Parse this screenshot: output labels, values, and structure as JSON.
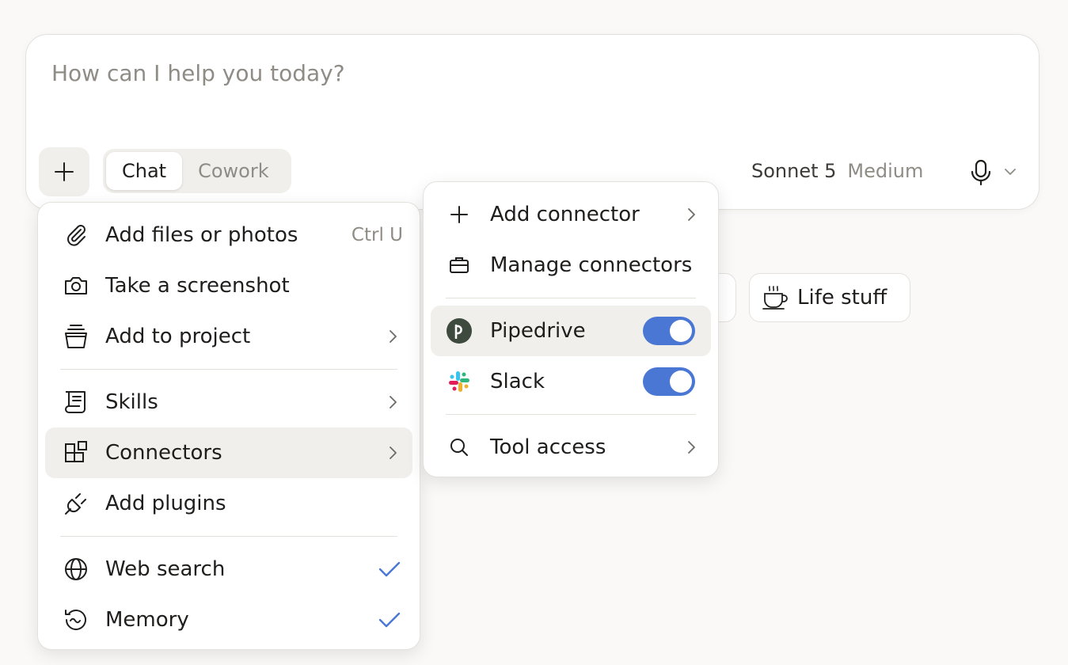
{
  "composer": {
    "placeholder": "How can I help you today?",
    "modes": [
      {
        "label": "Chat",
        "active": true
      },
      {
        "label": "Cowork",
        "active": false
      }
    ],
    "model_name": "Sonnet 5",
    "model_effort": "Medium"
  },
  "chips": {
    "life_stuff": "Life stuff"
  },
  "main_menu": {
    "add_files": {
      "label": "Add files or photos",
      "shortcut": "Ctrl U",
      "icon": "paperclip-icon"
    },
    "screenshot": {
      "label": "Take a screenshot",
      "icon": "camera-icon"
    },
    "add_to_project": {
      "label": "Add to project",
      "icon": "project-icon"
    },
    "skills": {
      "label": "Skills",
      "icon": "scroll-icon"
    },
    "connectors": {
      "label": "Connectors",
      "icon": "blocks-icon"
    },
    "add_plugins": {
      "label": "Add plugins",
      "icon": "plug-icon"
    },
    "web_search": {
      "label": "Web search",
      "icon": "globe-icon",
      "checked": true
    },
    "memory": {
      "label": "Memory",
      "icon": "memory-icon",
      "checked": true
    }
  },
  "sub_menu": {
    "add_connector": {
      "label": "Add connector",
      "icon": "plus-icon"
    },
    "manage_connectors": {
      "label": "Manage connectors",
      "icon": "briefcase-icon"
    },
    "pipedrive": {
      "label": "Pipedrive",
      "icon": "pipedrive-logo",
      "enabled": true
    },
    "slack": {
      "label": "Slack",
      "icon": "slack-logo",
      "enabled": true
    },
    "tool_access": {
      "label": "Tool access",
      "icon": "search-icon"
    }
  },
  "colors": {
    "accent_blue": "#4a77d4",
    "menu_highlight": "#f1efeb",
    "muted_text": "#8f8c86"
  }
}
